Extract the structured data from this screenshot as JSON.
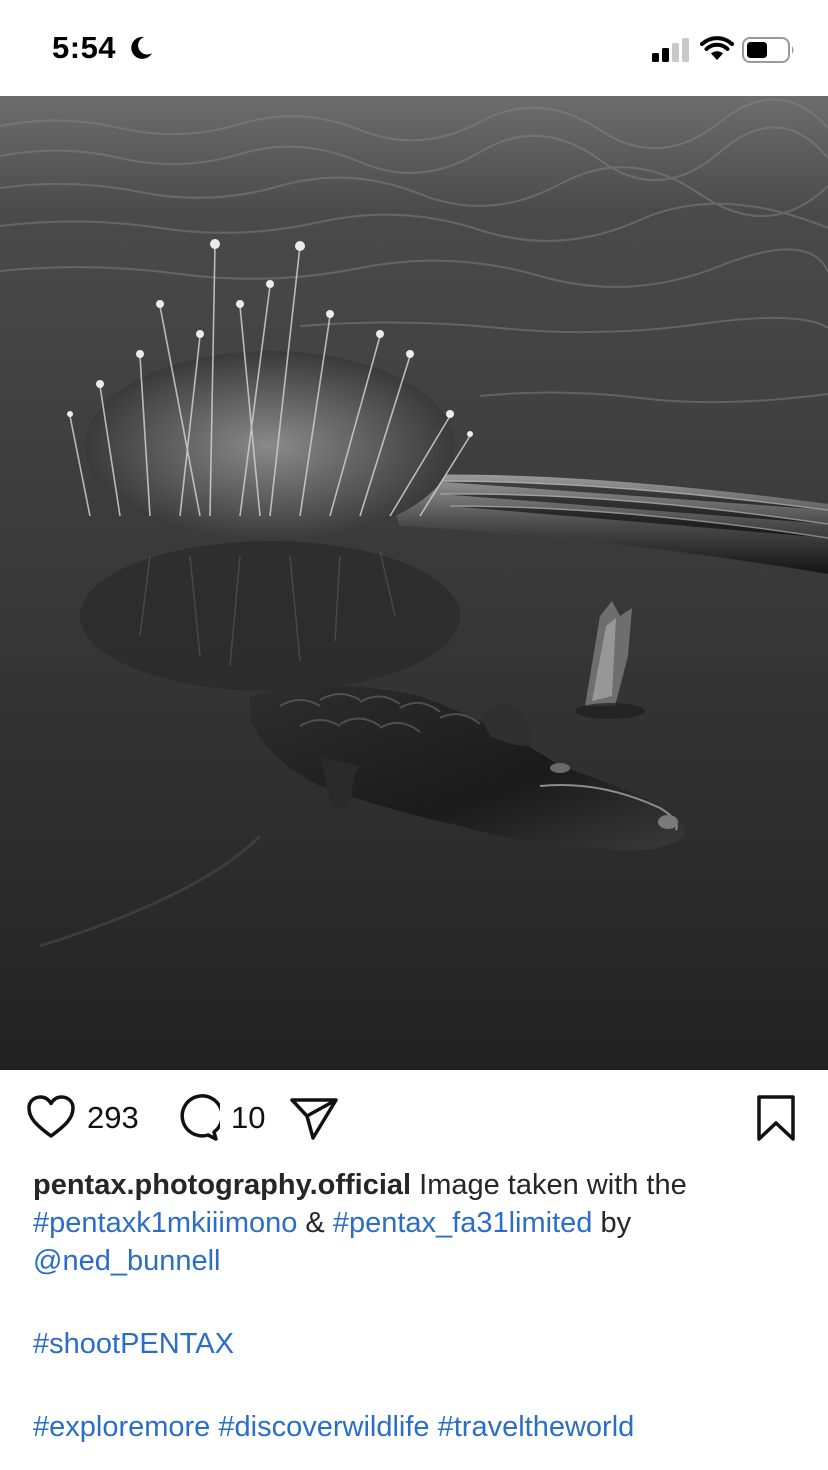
{
  "status_bar": {
    "time": "5:54"
  },
  "icons": {
    "moon": "moon-icon",
    "signal": "signal-icon",
    "wifi": "wifi-icon",
    "battery": "battery-icon",
    "like": "heart-icon",
    "comment": "comment-icon",
    "share": "paper-plane-icon",
    "save": "bookmark-icon"
  },
  "post": {
    "likes": "293",
    "comments": "10",
    "username": "pentax.photography.official",
    "caption_text_1": " Image taken with the ",
    "tag_camera": "#pentaxk1mkiiimono",
    "caption_amp": " & ",
    "tag_lens": "#pentax_fa31limited",
    "caption_by": " by ",
    "mention": "@ned_bunnell",
    "tag_shoot": "#shootPENTAX",
    "tag_explore": "#exploremore",
    "tag_discover": "#discoverwildlife",
    "tag_travel": "#traveltheworld"
  },
  "colors": {
    "link": "#2a6ec7",
    "text": "#262626"
  }
}
